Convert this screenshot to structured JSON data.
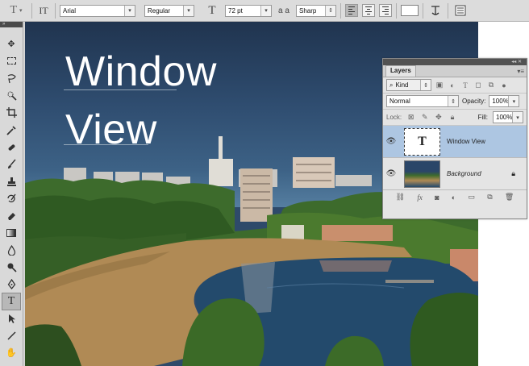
{
  "options_bar": {
    "tool_glyph": "T",
    "orient_glyph": "IT",
    "font_family": "Arial",
    "font_style": "Regular",
    "size_glyph": "T",
    "font_size": "72 pt",
    "aa_glyph": "a a",
    "antialias": "Sharp",
    "text_color": "#ffffff"
  },
  "canvas": {
    "line1": "Window",
    "line2": "View"
  },
  "layers_panel": {
    "tab": "Layers",
    "filter_label": "Kind",
    "blend_mode": "Normal",
    "opacity_label": "Opacity:",
    "opacity_value": "100%",
    "lock_label": "Lock:",
    "fill_label": "Fill:",
    "fill_value": "100%",
    "layers": [
      {
        "name": "Window View",
        "type": "text",
        "thumb_glyph": "T"
      },
      {
        "name": "Background",
        "type": "image"
      }
    ]
  }
}
